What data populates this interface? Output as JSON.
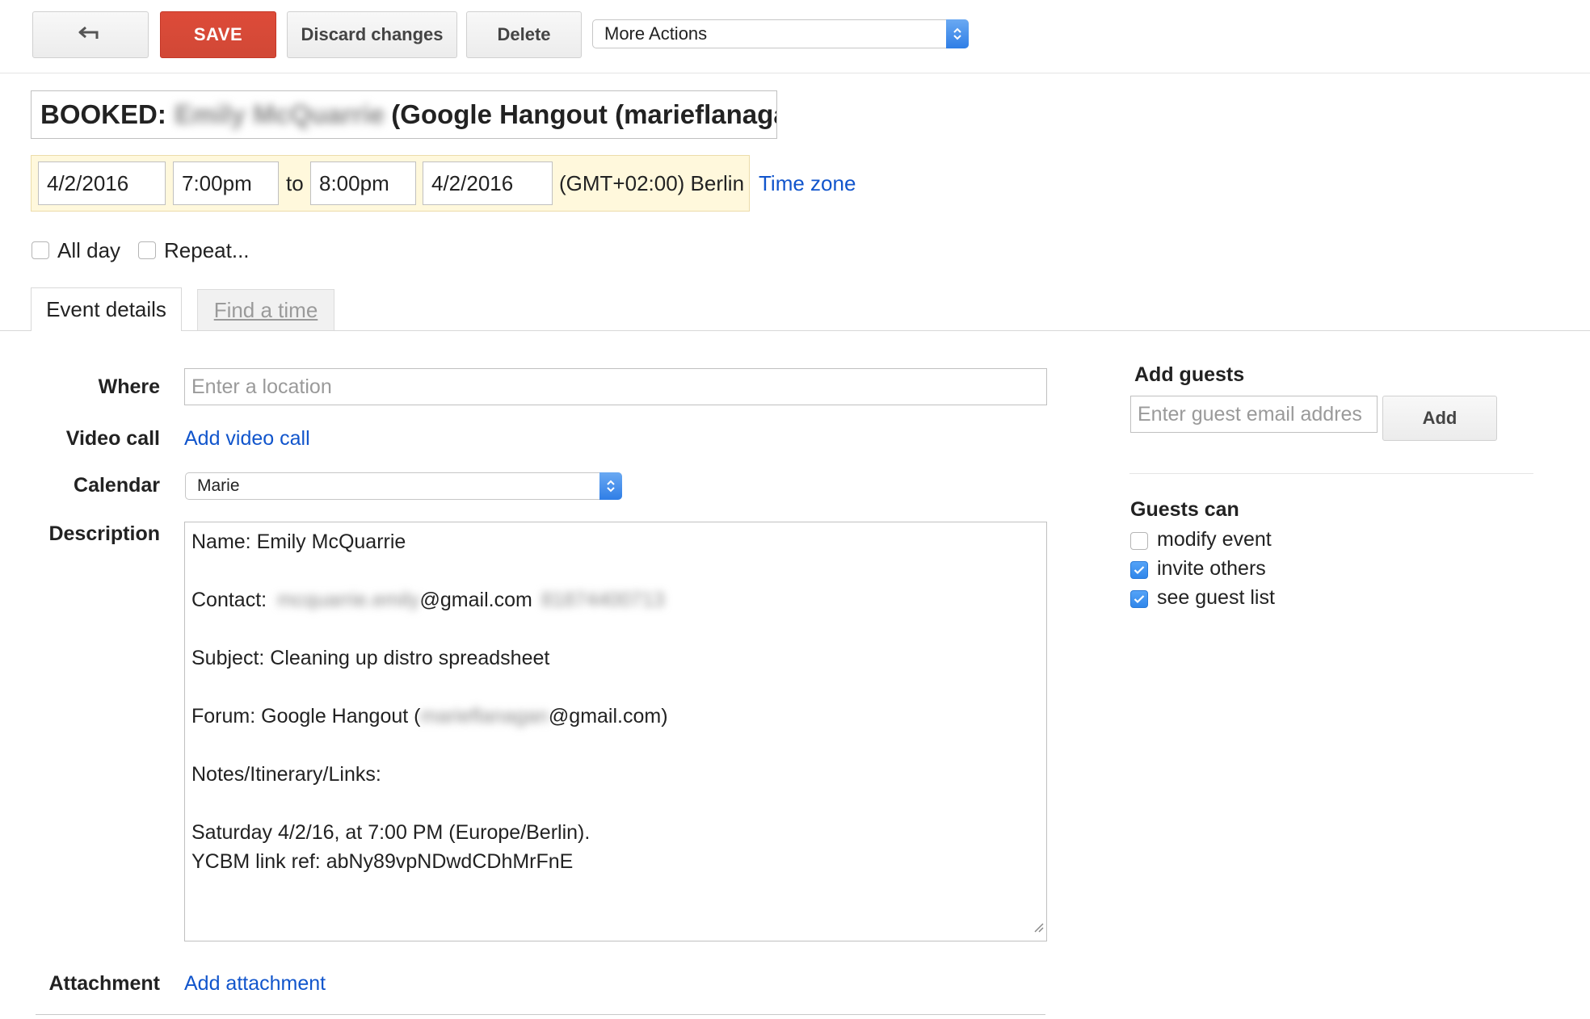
{
  "toolbar": {
    "back_icon": "back-arrow-icon",
    "save_label": "SAVE",
    "discard_label": "Discard changes",
    "delete_label": "Delete",
    "more_actions_label": "More Actions"
  },
  "title": {
    "prefix": "BOOKED:",
    "redacted_name": "Emily McQuarrie",
    "suffix": "(Google Hangout (marieflanaga"
  },
  "datetime": {
    "start_date": "4/2/2016",
    "start_time": "7:00pm",
    "to_label": "to",
    "end_time": "8:00pm",
    "end_date": "4/2/2016",
    "timezone": "(GMT+02:00) Berlin",
    "timezone_link": "Time zone"
  },
  "options": {
    "all_day_label": "All day",
    "all_day_checked": false,
    "repeat_label": "Repeat...",
    "repeat_checked": false
  },
  "tabs": [
    {
      "label": "Event details",
      "active": true
    },
    {
      "label": "Find a time",
      "active": false
    }
  ],
  "details": {
    "where_label": "Where",
    "where_placeholder": "Enter a location",
    "video_label": "Video call",
    "video_link": "Add video call",
    "calendar_label": "Calendar",
    "calendar_value": "Marie",
    "description_label": "Description",
    "description": {
      "name_line": "Name: Emily McQuarrie",
      "contact_prefix": "Contact:",
      "contact_redacted": "mcquarrie.emily",
      "contact_suffix": "@gmail.com",
      "contact_phone_redacted": "81874400713",
      "subject_line": "Subject: Cleaning up distro spreadsheet",
      "forum_prefix": "Forum: Google Hangout (",
      "forum_redacted": "marieflanagan",
      "forum_suffix": "@gmail.com)",
      "notes_line": "Notes/Itinerary/Links:",
      "schedule_line": "Saturday  4/2/16, at 7:00 PM (Europe/Berlin).",
      "ref_line": "YCBM link ref: abNy89vpNDwdCDhMrFnE"
    },
    "attachment_label": "Attachment",
    "attachment_link": "Add attachment"
  },
  "guests": {
    "heading": "Add guests",
    "input_placeholder": "Enter guest email addres",
    "add_label": "Add",
    "can_heading": "Guests can",
    "permissions": [
      {
        "label": "modify event",
        "checked": false
      },
      {
        "label": "invite others",
        "checked": true
      },
      {
        "label": "see guest list",
        "checked": true
      }
    ]
  },
  "colors": {
    "save_red": "#dd4b39",
    "link_blue": "#1155cc",
    "checkbox_blue": "#2f86ea",
    "date_bar_bg": "#fff8dc"
  }
}
